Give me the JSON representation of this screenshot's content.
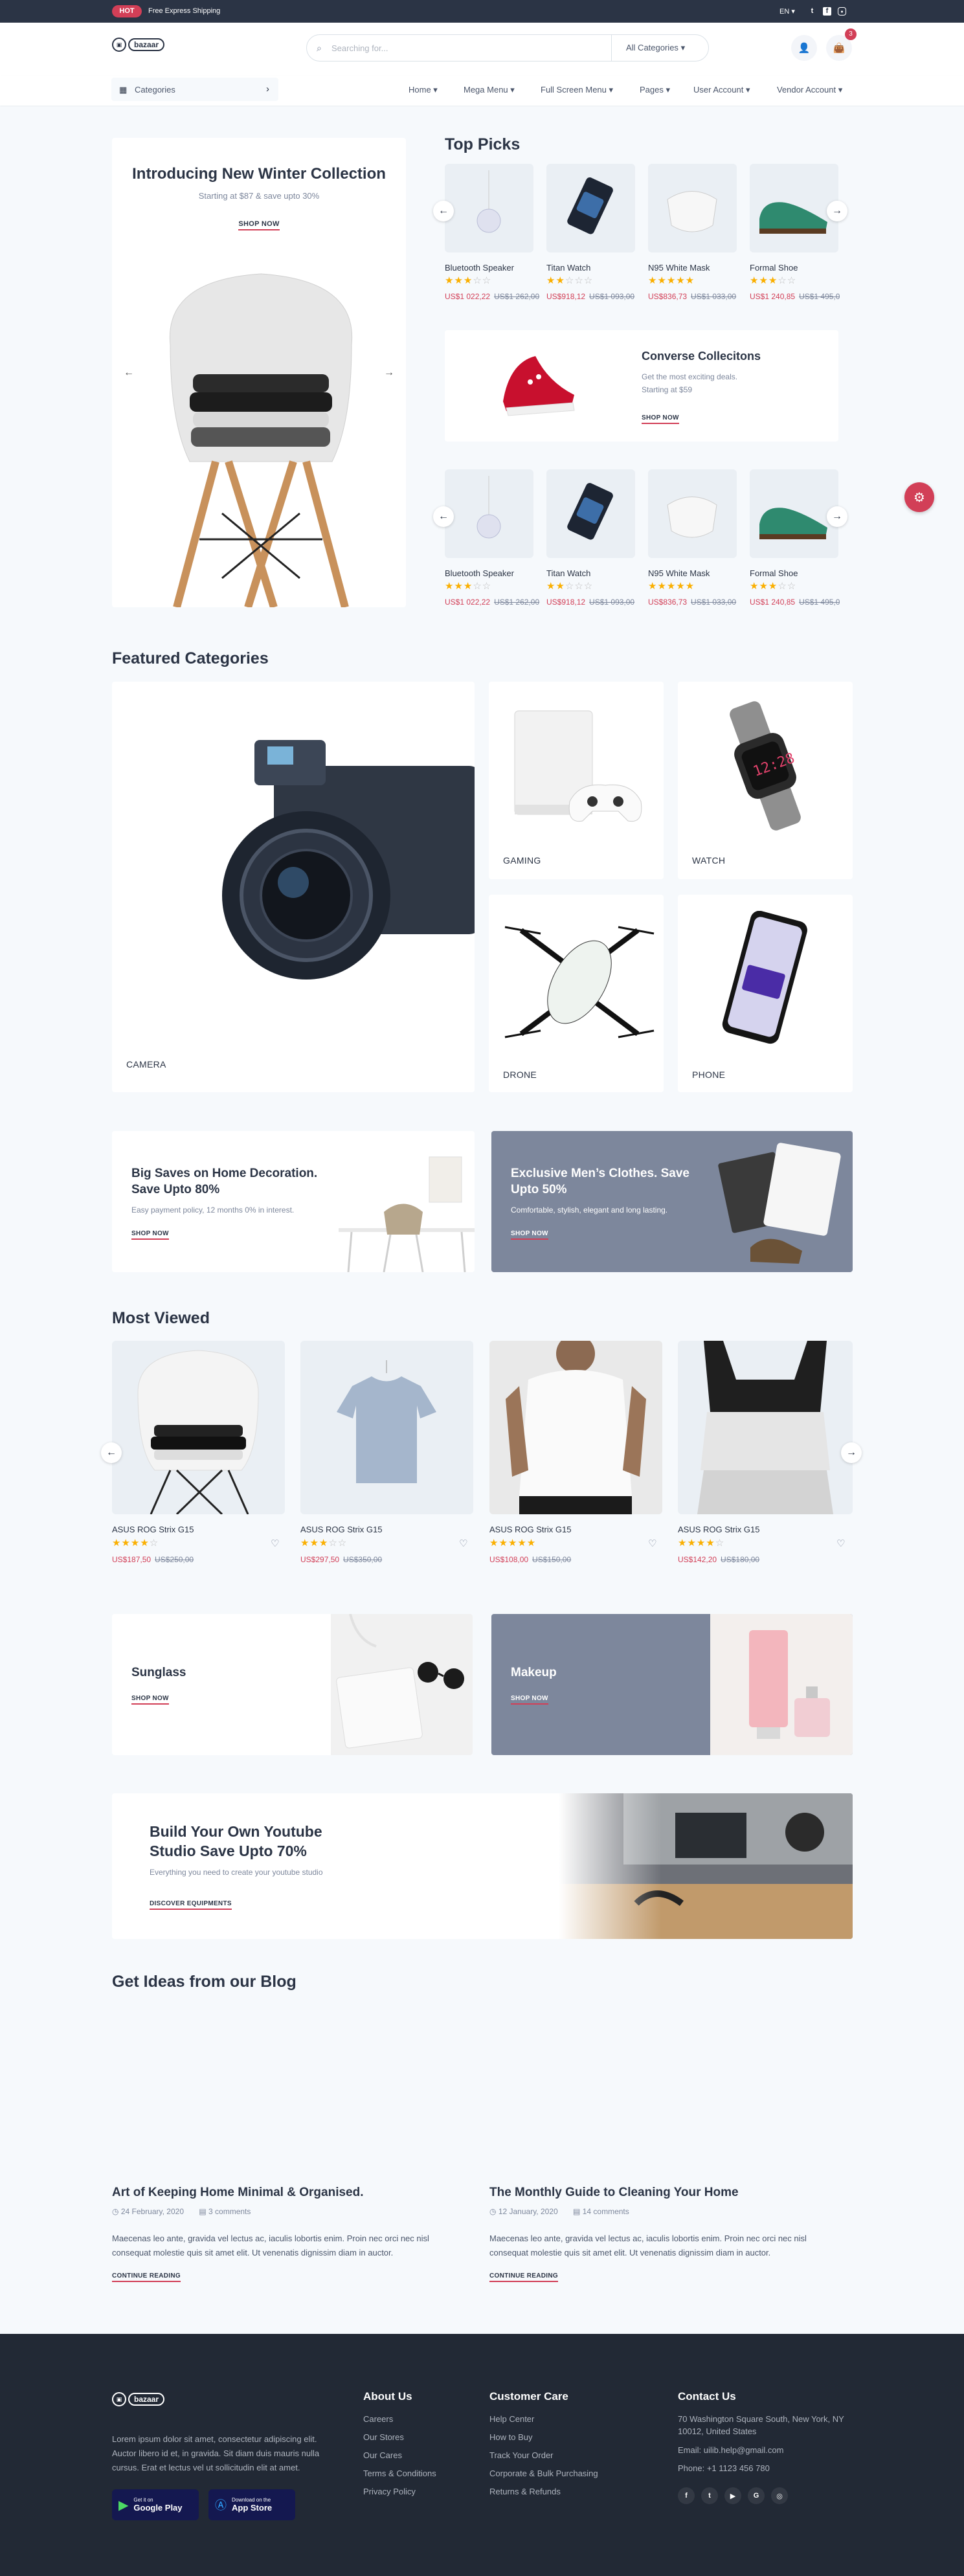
{
  "topbar": {
    "hot": "HOT",
    "shipping": "Free Express Shipping",
    "language": "EN",
    "social_icons": [
      "twitter-icon",
      "facebook-icon",
      "instagram-icon"
    ]
  },
  "header": {
    "logo": "bazaar",
    "search_placeholder": "Searching for...",
    "search_category": "All Categories",
    "cart_count": "3"
  },
  "nav": {
    "categories": "Categories",
    "items": [
      "Home",
      "Mega Menu",
      "Full Screen Menu",
      "Pages",
      "User Account",
      "Vendor Account"
    ]
  },
  "hero": {
    "title": "Introducing New Winter Collection",
    "subtitle": "Starting at $87 & save upto 30%",
    "cta": "SHOP NOW"
  },
  "top_picks": {
    "title": "Top Picks",
    "products": [
      {
        "name": "Bluetooth Speaker",
        "rating": 3,
        "price": "US$1 022,22",
        "old_price": "US$1 262,00"
      },
      {
        "name": "Titan Watch",
        "rating": 2,
        "price": "US$918,12",
        "old_price": "US$1 093,00"
      },
      {
        "name": "N95 White Mask",
        "rating": 5,
        "price": "US$836,73",
        "old_price": "US$1 033,00"
      },
      {
        "name": "Formal Shoe",
        "rating": 3,
        "price": "US$1 240,85",
        "old_price": "US$1 495,00"
      }
    ],
    "promo": {
      "title": "Converse Collecitons",
      "text": "Get the most exciting deals. Starting at $59",
      "cta": "SHOP NOW"
    }
  },
  "featured": {
    "title": "Featured Categories",
    "items": [
      "CAMERA",
      "GAMING",
      "WATCH",
      "DRONE",
      "PHONE"
    ]
  },
  "banners": [
    {
      "title": "Big Saves on Home Decoration. Save Upto 80%",
      "text": "Easy payment policy, 12 months 0% in interest.",
      "cta": "SHOP NOW"
    },
    {
      "title": "Exclusive Men’s Clothes. Save Upto 50%",
      "text": "Comfortable, stylish, elegant and long lasting.",
      "cta": "SHOP NOW"
    }
  ],
  "most_viewed": {
    "title": "Most Viewed",
    "products": [
      {
        "name": "ASUS ROG Strix G15",
        "rating": 4,
        "price": "US$187,50",
        "old_price": "US$250,00"
      },
      {
        "name": "ASUS ROG Strix G15",
        "rating": 3,
        "price": "US$297,50",
        "old_price": "US$350,00"
      },
      {
        "name": "ASUS ROG Strix G15",
        "rating": 5,
        "price": "US$108,00",
        "old_price": "US$150,00"
      },
      {
        "name": "ASUS ROG Strix G15",
        "rating": 4,
        "price": "US$142,20",
        "old_price": "US$180,00"
      }
    ]
  },
  "small_banners": [
    {
      "title": "Sunglass",
      "cta": "SHOP NOW"
    },
    {
      "title": "Makeup",
      "cta": "SHOP NOW"
    }
  ],
  "studio": {
    "title": "Build Your Own Youtube Studio Save Upto 70%",
    "text": "Everything you need to create your youtube studio",
    "cta": "DISCOVER EQUIPMENTS"
  },
  "blog": {
    "title": "Get Ideas from our Blog",
    "posts": [
      {
        "title": "Art of Keeping Home Minimal & Organised.",
        "date": "24 February, 2020",
        "comments": "3 comments",
        "excerpt": "Maecenas leo ante, gravida vel lectus ac, iaculis lobortis enim. Proin nec orci nec nisl consequat molestie quis sit amet elit. Ut venenatis dignissim diam in auctor.",
        "cta": "CONTINUE READING"
      },
      {
        "title": "The Monthly Guide to Cleaning Your Home",
        "date": "12 January, 2020",
        "comments": "14 comments",
        "excerpt": "Maecenas leo ante, gravida vel lectus ac, iaculis lobortis enim. Proin nec orci nec nisl consequat molestie quis sit amet elit. Ut venenatis dignissim diam in auctor.",
        "cta": "CONTINUE READING"
      }
    ]
  },
  "footer": {
    "about_text": "Lorem ipsum dolor sit amet, consectetur adipiscing elit. Auctor libero id et, in gravida. Sit diam duis mauris nulla cursus. Erat et lectus vel ut sollicitudin elit at amet.",
    "google_small": "Get it on",
    "google_big": "Google Play",
    "apple_small": "Download on the",
    "apple_big": "App Store",
    "about": {
      "title": "About Us",
      "links": [
        "Careers",
        "Our Stores",
        "Our Cares",
        "Terms & Conditions",
        "Privacy Policy"
      ]
    },
    "care": {
      "title": "Customer Care",
      "links": [
        "Help Center",
        "How to Buy",
        "Track Your Order",
        "Corporate & Bulk Purchasing",
        "Returns & Refunds"
      ]
    },
    "contact": {
      "title": "Contact Us",
      "address": "70 Washington Square South, New York, NY 10012, United States",
      "email": "Email: uilib.help@gmail.com",
      "phone": "Phone: +1 1123 456 780"
    }
  },
  "colors": {
    "primary": "#d23f57",
    "dark": "#2b3445",
    "footer": "#222935",
    "banner_gray": "#7d879c",
    "background": "#f6f9fc"
  }
}
